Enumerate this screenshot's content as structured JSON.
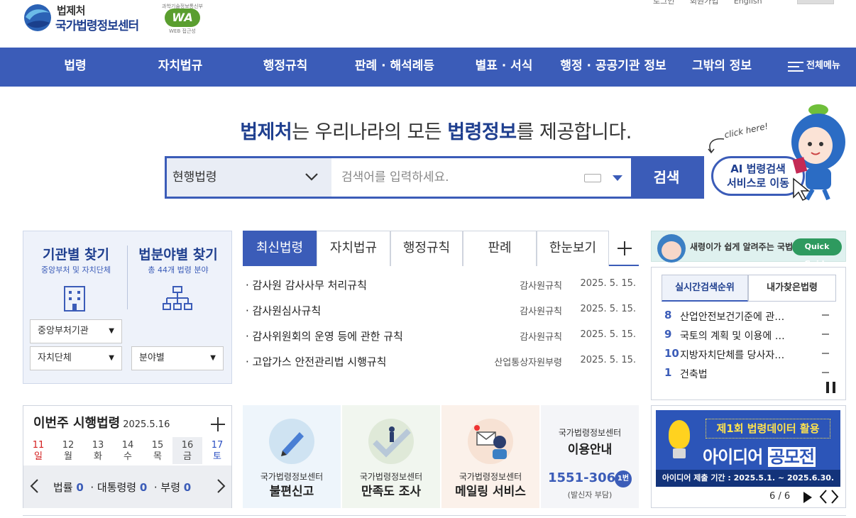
{
  "header": {
    "org": "법제처",
    "site": "국가법령정보센터",
    "wa_badge": {
      "top": "과학기술정보통신부",
      "mark": "WA",
      "bottom": "WEB 접근성"
    },
    "util_links": [
      "로그인",
      "회원가입",
      "English"
    ]
  },
  "gnb": {
    "items": [
      "법령",
      "자치법규",
      "행정규칙",
      "판례 · 해석례등",
      "별표 · 서식",
      "행정 · 공공기관 정보",
      "그밖의 정보"
    ],
    "all_menu": "전체메뉴"
  },
  "hero": {
    "brand": "법제처",
    "text_1": "는 우리나라의 모든 ",
    "strong": "법령정보",
    "text_2": "를 제공합니다."
  },
  "search": {
    "scope": "현행법령",
    "placeholder": "검색어를 입력하세요.",
    "button": "검색"
  },
  "ai": {
    "click_here": "click here!",
    "line1": "AI 법령검색",
    "line2": "서비스로 이동"
  },
  "find": {
    "agency": {
      "title": "기관별 찾기",
      "sub": "중앙부처 및 자치단체"
    },
    "field": {
      "title": "법분야별 찾기",
      "sub": "총 44개 법령 분야"
    },
    "selects": [
      "중앙부처기관",
      "자치단체",
      "분야별"
    ]
  },
  "news": {
    "tabs": [
      "최신법령",
      "자치법규",
      "행정규칙",
      "판례",
      "한눈보기"
    ],
    "rows": [
      {
        "title": "· 감사원 감사사무 처리규칙",
        "category": "감사원규칙",
        "date": "2025. 5. 15."
      },
      {
        "title": "· 감사원심사규칙",
        "category": "감사원규칙",
        "date": "2025. 5. 15."
      },
      {
        "title": "· 감사위원회의 운영 등에 관한 규칙",
        "category": "감사원규칙",
        "date": "2025. 5. 15."
      },
      {
        "title": "· 고압가스 안전관리법 시행규칙",
        "category": "산업통상자원부령",
        "date": "2025. 5. 15."
      }
    ]
  },
  "quick": {
    "text": "새령이가 쉽게 알려주는 국법",
    "pill": "Quick Guide"
  },
  "rank": {
    "tabs": [
      "실시간검색순위",
      "내가찾은법령"
    ],
    "rows": [
      {
        "n": "8",
        "k": "산업안전보건기준에 관…"
      },
      {
        "n": "9",
        "k": "국토의 계획 및 이용에 …"
      },
      {
        "n": "10",
        "k": "지방자치단체를 당사자…"
      },
      {
        "n": "1",
        "k": "건축법"
      }
    ]
  },
  "weekly": {
    "title": "이번주 시행법령",
    "date": "2025.5.16",
    "days": [
      {
        "num": "11",
        "wd": "일",
        "color": "#d42020"
      },
      {
        "num": "12",
        "wd": "월",
        "color": "#444444"
      },
      {
        "num": "13",
        "wd": "화",
        "color": "#444444"
      },
      {
        "num": "14",
        "wd": "수",
        "color": "#444444"
      },
      {
        "num": "15",
        "wd": "목",
        "color": "#444444"
      },
      {
        "num": "16",
        "wd": "금",
        "color": "#444444"
      },
      {
        "num": "17",
        "wd": "토",
        "color": "#2b4fc2"
      }
    ],
    "stats": [
      {
        "label": "법률",
        "value": "0"
      },
      {
        "label": "대통령령",
        "value": "0"
      },
      {
        "label": "부령",
        "value": "0"
      }
    ]
  },
  "services": [
    {
      "s1": "국가법령정보센터",
      "s2": "불편신고"
    },
    {
      "s1": "국가법령정보센터",
      "s2": "만족도 조사"
    },
    {
      "s1": "국가법령정보센터",
      "s2": "메일링 서비스"
    },
    {
      "s1": "국가법령정보센터",
      "s2": "이용안내",
      "phone": "1551-3060",
      "ext": "1번",
      "note": "(발신자 부담)"
    }
  ],
  "contest": {
    "title": "제1회 법령데이터 활용",
    "big1": "아이디어",
    "big2": "공모전",
    "period": "아이디어 제출 기간 : 2025.5.1. ~ 2025.6.30.",
    "page": "6 / 6"
  }
}
